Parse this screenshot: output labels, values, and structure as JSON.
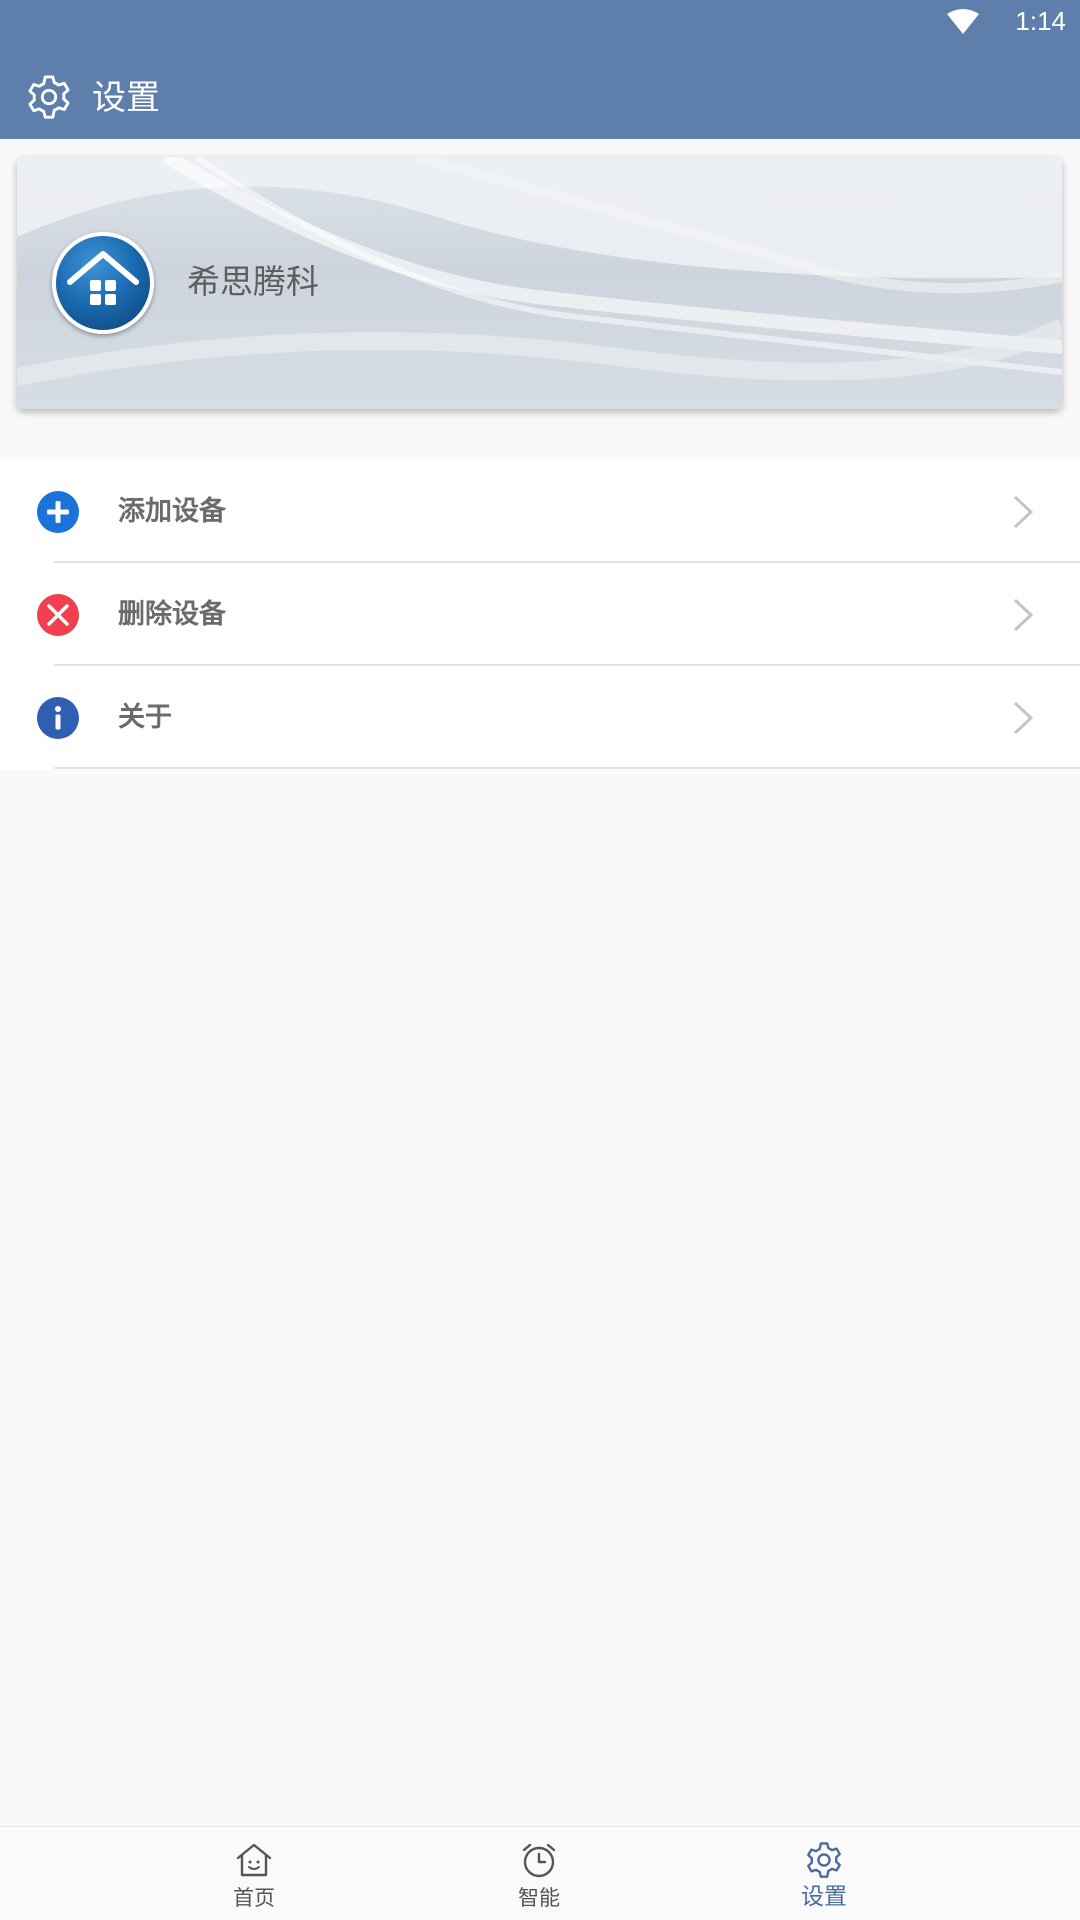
{
  "status_bar": {
    "time": "1:14",
    "wifi_icon": "wifi-icon"
  },
  "header": {
    "title": "设置",
    "icon": "gear-icon",
    "color": "#5e7eab"
  },
  "profile": {
    "name": "希思腾科",
    "avatar_icon": "home-logo-icon"
  },
  "menu": {
    "items": [
      {
        "label": "添加设备",
        "icon": "add-circle-icon",
        "icon_color": "#1a73d9"
      },
      {
        "label": "删除设备",
        "icon": "close-circle-icon",
        "icon_color": "#f0404f"
      },
      {
        "label": "关于",
        "icon": "info-icon",
        "icon_color": "#2f5fb0"
      }
    ]
  },
  "bottom_nav": {
    "tabs": [
      {
        "label": "首页",
        "icon": "home-icon",
        "active": false
      },
      {
        "label": "智能",
        "icon": "alarm-clock-icon",
        "active": false
      },
      {
        "label": "设置",
        "icon": "gear-icon",
        "active": true
      }
    ],
    "active_color": "#4a6aa0"
  }
}
